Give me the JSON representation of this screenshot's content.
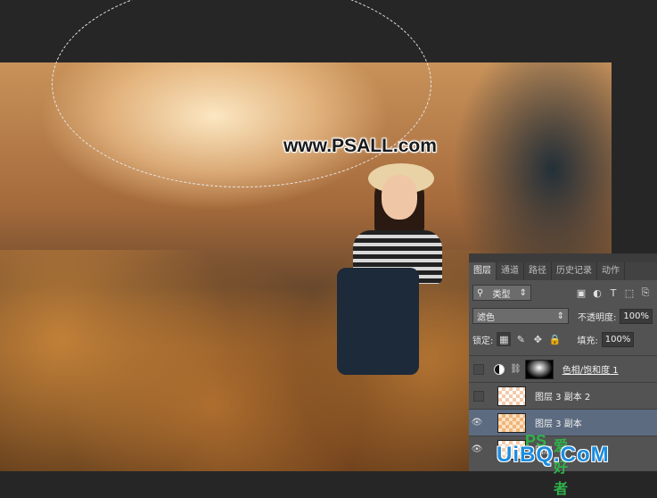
{
  "watermark": "www.PSALL.com",
  "panel": {
    "tabs": [
      "图层",
      "通道",
      "路径",
      "历史记录",
      "动作"
    ],
    "active_tab": "图层",
    "filter": {
      "label": "类型"
    },
    "filter_icons": [
      "image-filter-icon",
      "adjustment-filter-icon",
      "type-filter-icon",
      "shape-filter-icon",
      "smart-object-filter-icon"
    ],
    "blend_mode": "滤色",
    "opacity_label": "不透明度:",
    "opacity_value": "100%",
    "lock_label": "锁定:",
    "fill_label": "填充:",
    "fill_value": "100%",
    "layers": [
      {
        "name": "色相/饱和度 1",
        "visible": false,
        "type": "adjustment"
      },
      {
        "name": "图层 3 副本 2",
        "visible": false,
        "type": "pixel"
      },
      {
        "name": "图层 3 副本",
        "visible": true,
        "type": "pixel",
        "selected": true
      },
      {
        "name": "图层",
        "visible": true,
        "type": "pixel"
      }
    ]
  },
  "site_mark": {
    "ps": "PS",
    "cn": "爱好者",
    "uibq": "UiBQ.CoM"
  }
}
